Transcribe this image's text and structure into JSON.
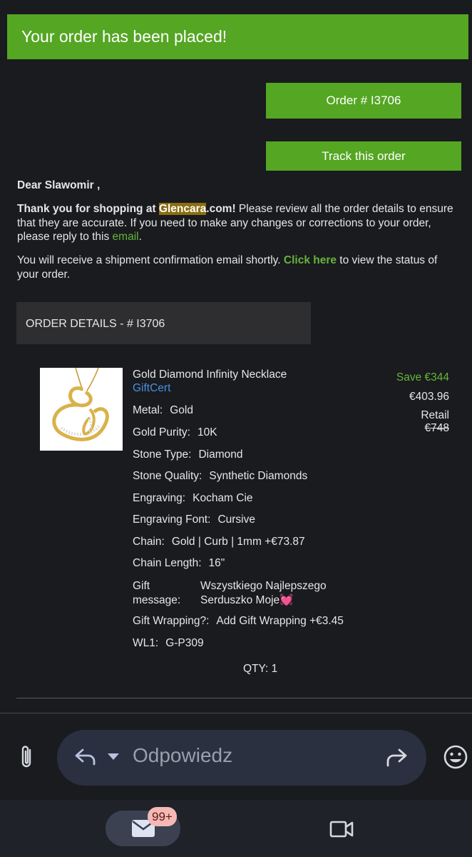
{
  "banner": {
    "text": "Your order has been placed!"
  },
  "buttons": {
    "order": "Order # I3706",
    "track": "Track this order"
  },
  "greeting": "Dear Slawomir ,",
  "thank_you": {
    "prefix": "Thank you for shopping at ",
    "brand": "Glencara",
    "suffix": ".com!",
    "body": " Please review all the order details to ensure that they are accurate. If you need to make any changes or corrections to your order, please reply to this ",
    "email_link": "email",
    "end": "."
  },
  "shipment": {
    "before": "You will receive a shipment confirmation email shortly. ",
    "link": "Click here",
    "after": " to view the status of your order."
  },
  "order_details_header": "ORDER DETAILS - # I3706",
  "product": {
    "title": "Gold Diamond Infinity Necklace",
    "cert": "GiftCert",
    "attributes": [
      {
        "key": "Metal:",
        "value": "Gold"
      },
      {
        "key": "Gold Purity:",
        "value": "10K"
      },
      {
        "key": "Stone Type:",
        "value": "Diamond"
      },
      {
        "key": "Stone Quality:",
        "value": "Synthetic Diamonds"
      },
      {
        "key": "Engraving:",
        "value": "Kocham Cie"
      },
      {
        "key": "Engraving Font:",
        "value": "Cursive"
      },
      {
        "key": "Chain:",
        "value": "Gold | Curb | 1mm +€73.87"
      },
      {
        "key": "Chain Length:",
        "value": "16\""
      }
    ],
    "gift_message": {
      "key": "Gift message:",
      "value_line1": "Wszystkiego Najlepszego",
      "value_line2": "Serduszko Moje",
      "emoji": "💓"
    },
    "gift_wrapping": {
      "key": "Gift Wrapping?:",
      "value": "Add Gift Wrapping +€3.45"
    },
    "wl1": {
      "key": "WL1:",
      "value": "G-P309"
    },
    "qty": "QTY: 1",
    "save": "Save €344",
    "price": "€403.96",
    "retail_label": "Retail",
    "retail_price": "€748"
  },
  "reply": {
    "label": "Odpowiedz"
  },
  "nav": {
    "badge": "99+"
  },
  "colors": {
    "accent": "#54a623",
    "link_blue": "#4b8fe0"
  },
  "icons": [
    "paperclip-icon",
    "reply-icon",
    "chevron-down-icon",
    "forward-icon",
    "emoji-icon",
    "mail-icon",
    "video-icon"
  ]
}
